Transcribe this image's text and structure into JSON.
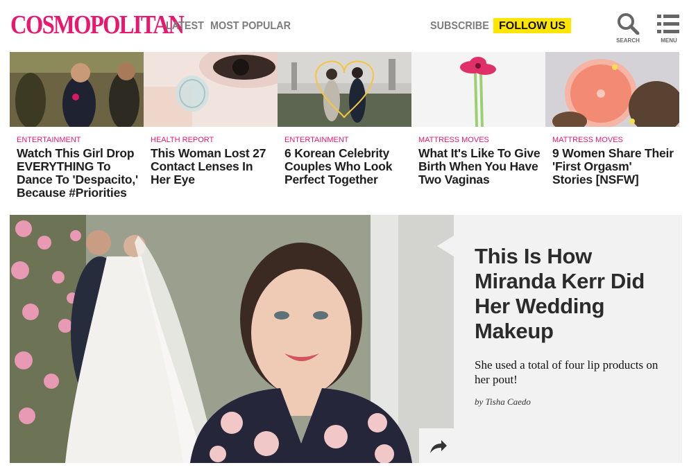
{
  "header": {
    "logo": "COSMOPOLITAN",
    "nav": [
      "LATEST",
      "MOST POPULAR"
    ],
    "subscribe": "SUBSCRIBE",
    "follow": "FOLLOW US",
    "search_label": "SEARCH",
    "menu_label": "MENU"
  },
  "articles": [
    {
      "category": "ENTERTAINMENT",
      "title": "Watch This Girl Drop EVERYTHING To Dance To 'Despacito,' Because #Priorities"
    },
    {
      "category": "HEALTH REPORT",
      "title": "This Woman Lost 27 Contact Lenses In Her Eye"
    },
    {
      "category": "ENTERTAINMENT",
      "title": "6 Korean Celebrity Couples Who Look Perfect Together"
    },
    {
      "category": "MATTRESS MOVES",
      "title": "What It's Like To Give Birth When You Have Two Vaginas"
    },
    {
      "category": "MATTRESS MOVES",
      "title": "9 Women Share Their 'First Orgasm' Stories [NSFW]"
    }
  ],
  "feature": {
    "title": "This Is How Miranda Kerr Did Her Wedding Makeup",
    "dek": "She used a total of four lip products on her pout!",
    "byline": "by Tisha Caedo"
  },
  "colors": {
    "brand": "#e9186e",
    "follow_bg": "#ffe500",
    "panel_bg": "#f2f2f2"
  },
  "icons": [
    "search-icon",
    "menu-icon",
    "share-icon"
  ]
}
